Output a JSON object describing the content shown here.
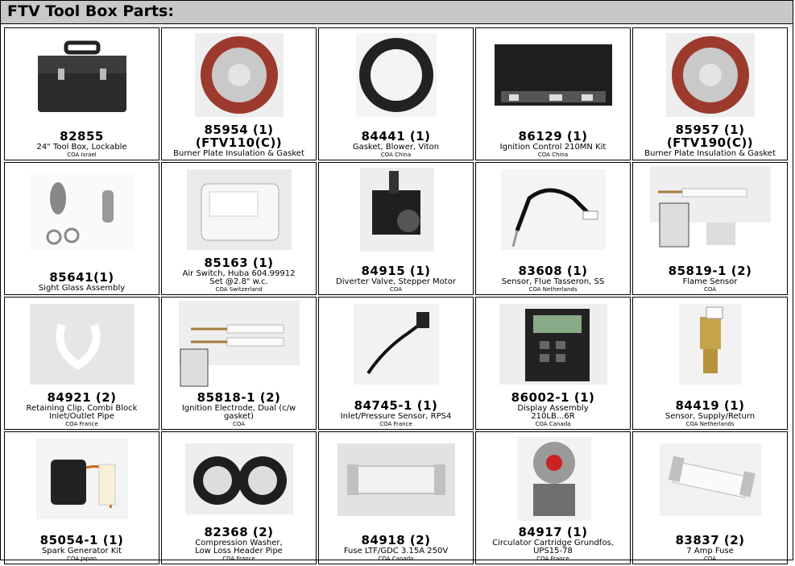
{
  "title": "FTV Tool Box Parts:",
  "rows": [
    [
      {
        "number": "82855",
        "desc": "24\" Tool Box, Lockable",
        "coa": "COA  Israel",
        "icon": "toolbox-icon"
      },
      {
        "number": "85954 (1)\n(FTV110(C))",
        "desc": "Burner Plate Insulation & Gasket",
        "coa": "",
        "icon": "burner-plate-icon"
      },
      {
        "number": "84441 (1)",
        "desc": "Gasket, Blower, Viton",
        "coa": "COA  China",
        "icon": "gasket-icon"
      },
      {
        "number": "86129 (1)",
        "desc": "Ignition Control 210MN Kit",
        "coa": "COA  China",
        "icon": "control-board-icon"
      },
      {
        "number": "85957 (1)\n(FTV190(C))",
        "desc": "Burner Plate Insulation & Gasket",
        "coa": "",
        "icon": "burner-plate-icon"
      }
    ],
    [
      {
        "number": "85641(1)",
        "desc": "Sight Glass Assembly",
        "coa": "",
        "icon": "sight-glass-icon"
      },
      {
        "number": "85163 (1)",
        "desc": "Air Switch, Huba 604.99912\nSet @2.8\" w.c.",
        "coa": "COA  Switzerland",
        "icon": "air-switch-icon"
      },
      {
        "number": "84915 (1)",
        "desc": "Diverter Valve, Stepper Motor",
        "coa": "COA",
        "icon": "stepper-motor-icon"
      },
      {
        "number": "83608 (1)",
        "desc": "Sensor, Flue Tasseron, SS",
        "coa": "COA  Netherlands",
        "icon": "flue-sensor-icon"
      },
      {
        "number": "85819-1 (2)",
        "desc": "Flame Sensor",
        "coa": "COA",
        "icon": "flame-sensor-icon"
      }
    ],
    [
      {
        "number": "84921 (2)",
        "desc": "Retaining Clip, Combi Block\nInlet/Outlet Pipe",
        "coa": "COA  France",
        "icon": "clip-icon"
      },
      {
        "number": "85818-1 (2)",
        "desc": "Ignition Electrode, Dual (c/w\ngasket)",
        "coa": "COA",
        "icon": "electrode-icon"
      },
      {
        "number": "84745-1 (1)",
        "desc": "Inlet/Pressure Sensor, RPS4",
        "coa": "COA  France",
        "icon": "pressure-sensor-icon"
      },
      {
        "number": "86002-1 (1)",
        "desc": "Display Assembly\n210LB...6R",
        "coa": "COA  Canada",
        "icon": "display-icon"
      },
      {
        "number": "84419 (1)",
        "desc": "Sensor, Supply/Return",
        "coa": "COA  Netherlands",
        "icon": "supply-sensor-icon"
      }
    ],
    [
      {
        "number": "85054-1 (1)",
        "desc": "Spark Generator Kit",
        "coa": "COA  Japan",
        "icon": "spark-generator-icon"
      },
      {
        "number": "82368 (2)",
        "desc": "Compression Washer,\nLow Loss Header Pipe",
        "coa": "COA  France",
        "icon": "washer-icon"
      },
      {
        "number": "84918 (2)",
        "desc": "Fuse LTF/GDC 3.15A 250V",
        "coa": "COA  Canada",
        "icon": "fuse-icon"
      },
      {
        "number": "84917 (1)",
        "desc": "Circulator Cartridge Grundfos,\nUPS15-78",
        "coa": "COA  France",
        "icon": "pump-cartridge-icon"
      },
      {
        "number": "83837 (2)",
        "desc": "7 Amp Fuse",
        "coa": "COA",
        "icon": "glass-fuse-icon"
      }
    ]
  ]
}
